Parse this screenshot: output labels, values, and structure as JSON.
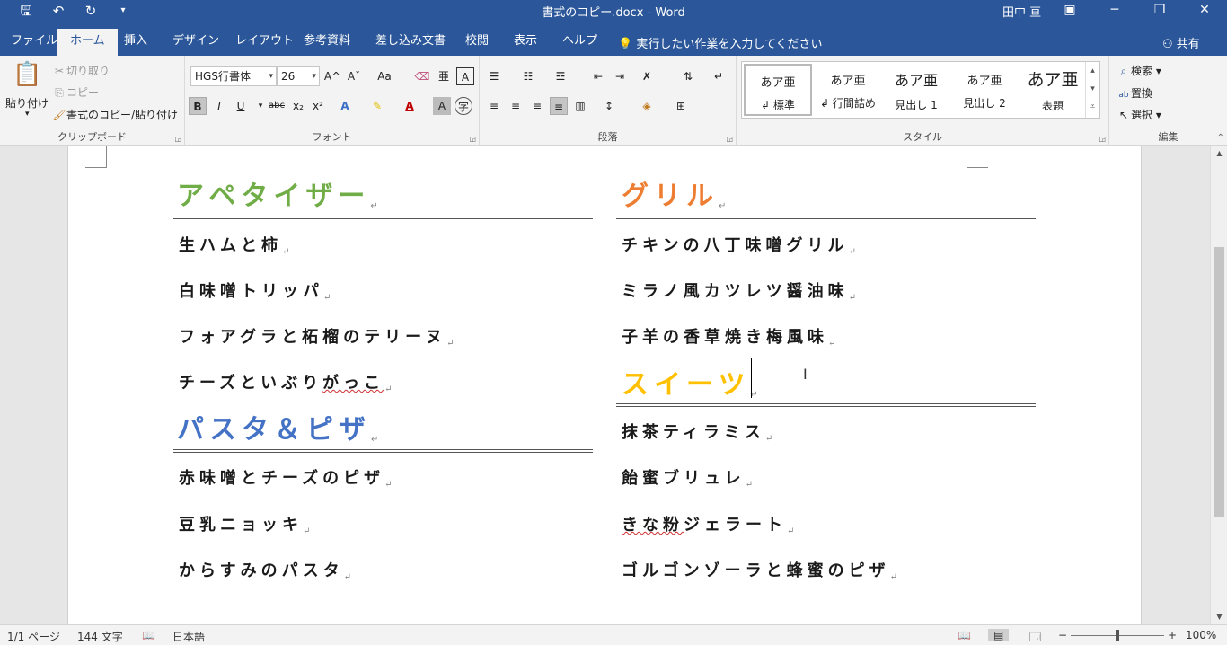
{
  "window": {
    "title": "書式のコピー.docx - Word",
    "user": "田中 亘",
    "qat": [
      "save-icon",
      "undo-icon",
      "redo-icon",
      "customize-icon"
    ],
    "controls": [
      "ribbon-display-icon",
      "minimize-icon",
      "restore-icon",
      "close-icon"
    ]
  },
  "tabs": [
    "ファイル",
    "ホーム",
    "挿入",
    "デザイン",
    "レイアウト",
    "参考資料",
    "差し込み文書",
    "校閲",
    "表示",
    "ヘルプ"
  ],
  "active_tab": "ホーム",
  "tell_me": "実行したい作業を入力してください",
  "share": "共有",
  "ribbon": {
    "clipboard": {
      "label": "クリップボード",
      "paste": "貼り付け",
      "cut": "切り取り",
      "copy": "コピー",
      "format_painter": "書式のコピー/貼り付け"
    },
    "font": {
      "label": "フォント",
      "font_name": "HGS行書体",
      "font_size": "26",
      "grow": "A^",
      "shrink": "Aˇ",
      "case": "Aa",
      "bold": "B",
      "italic": "I",
      "underline": "U",
      "strike": "abc",
      "subscript": "x₂",
      "superscript": "x²"
    },
    "paragraph": {
      "label": "段落"
    },
    "styles": {
      "label": "スタイル",
      "items": [
        {
          "sample": "あア亜",
          "name": "標準"
        },
        {
          "sample": "あア亜",
          "name": "行間詰め"
        },
        {
          "sample": "あア亜",
          "name": "見出し 1"
        },
        {
          "sample": "あア亜",
          "name": "見出し 2"
        },
        {
          "sample": "あア亜",
          "name": "表題"
        }
      ]
    },
    "editing": {
      "label": "編集",
      "find": "検索",
      "replace": "置換",
      "select": "選択"
    }
  },
  "document": {
    "left": {
      "sections": [
        {
          "heading": "アペタイザー",
          "color": "#70ad47",
          "items": [
            "生ハムと柿",
            "白味噌トリッパ",
            "フォアグラと柘榴のテリーヌ",
            "チーズといぶりがっこ"
          ]
        },
        {
          "heading": "パスタ＆ピザ",
          "color": "#4472c4",
          "items": [
            "赤味噌とチーズのピザ",
            "豆乳ニョッキ",
            "からすみのパスタ"
          ]
        }
      ]
    },
    "right": {
      "sections": [
        {
          "heading": "グリル",
          "color": "#ed7d31",
          "items": [
            "チキンの八丁味噌グリル",
            "ミラノ風カツレツ醤油味",
            "子羊の香草焼き梅風味"
          ]
        },
        {
          "heading": "スイーツ",
          "color": "#ffc000",
          "items": [
            "抹茶ティラミス",
            "飴蜜ブリュレ",
            "きな粉ジェラート",
            "ゴルゴンゾーラと蜂蜜のピザ"
          ]
        }
      ]
    }
  },
  "status": {
    "page": "1/1 ページ",
    "words": "144 文字",
    "language": "日本語",
    "zoom": "100%",
    "zoom_value": 100
  }
}
